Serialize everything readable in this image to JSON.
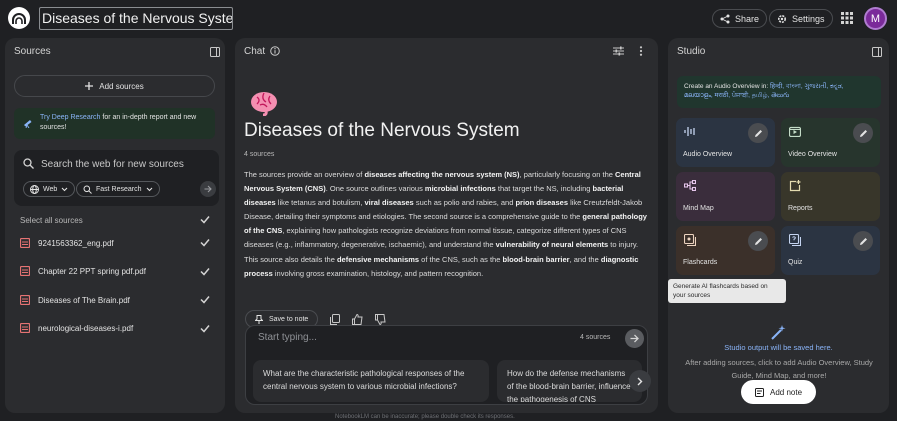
{
  "app": {
    "notebook_title": "Diseases of the Nervous System",
    "share_label": "Share",
    "settings_label": "Settings",
    "avatar_initial": "M",
    "disclaimer": "NotebookLM can be inaccurate; please double check its responses."
  },
  "sources_panel": {
    "title": "Sources",
    "add_label": "Add sources",
    "deep_research_link": "Try Deep Research",
    "deep_research_text": " for an in-depth report and new sources!",
    "search_placeholder": "Search the web for new sources",
    "chip_web": "Web",
    "chip_research": "Fast Research",
    "select_all_label": "Select all sources",
    "items": [
      {
        "label": "9241563362_eng.pdf",
        "checked": true
      },
      {
        "label": "Chapter 22 PPT spring pdf.pdf",
        "checked": true
      },
      {
        "label": "Diseases of The Brain.pdf",
        "checked": true
      },
      {
        "label": "neurological-diseases-i.pdf",
        "checked": true
      }
    ]
  },
  "chat_panel": {
    "title": "Chat",
    "heading": "Diseases of the Nervous System",
    "source_count": "4 sources",
    "save_note_label": "Save to note",
    "input_placeholder": "Start typing...",
    "input_source_count": "4 sources",
    "suggestions": [
      "What are the characteristic pathological responses of the central nervous system to various microbial infections?",
      "How do the defense mechanisms of the blood-brain barrier, influence the pathogenesis of CNS infections?"
    ]
  },
  "studio_panel": {
    "title": "Studio",
    "audio_banner_prefix": "Create an Audio Overview in: ",
    "audio_banner_langs": "हिन्दी, বাংলা, ગુજરાતી, ಕನ್ನಡ, മലയാളം, मराठी, ਪੰਜਾਬੀ, தமிழ், తెలుగు",
    "tiles": {
      "audio_overview": "Audio Overview",
      "video_overview": "Video Overview",
      "mind_map": "Mind Map",
      "reports": "Reports",
      "flashcards": "Flashcards",
      "quiz": "Quiz"
    },
    "tooltip": "Generate AI flashcards based on your sources",
    "output_title": "Studio output will be saved here.",
    "output_desc": "After adding sources, click to add Audio Overview, Study Guide, Mind Map, and more!",
    "add_note_label": "Add note"
  },
  "colors": {
    "background": "#1f2023",
    "panel": "#2b2c2f",
    "link": "#8ab4f8",
    "audio_tile": "#2b3442",
    "video_tile": "#27352d",
    "mindmap_tile": "#3a2d3c",
    "reports_tile": "#38362a",
    "flashcards_tile": "#3b302a",
    "quiz_tile": "#2b3442"
  }
}
